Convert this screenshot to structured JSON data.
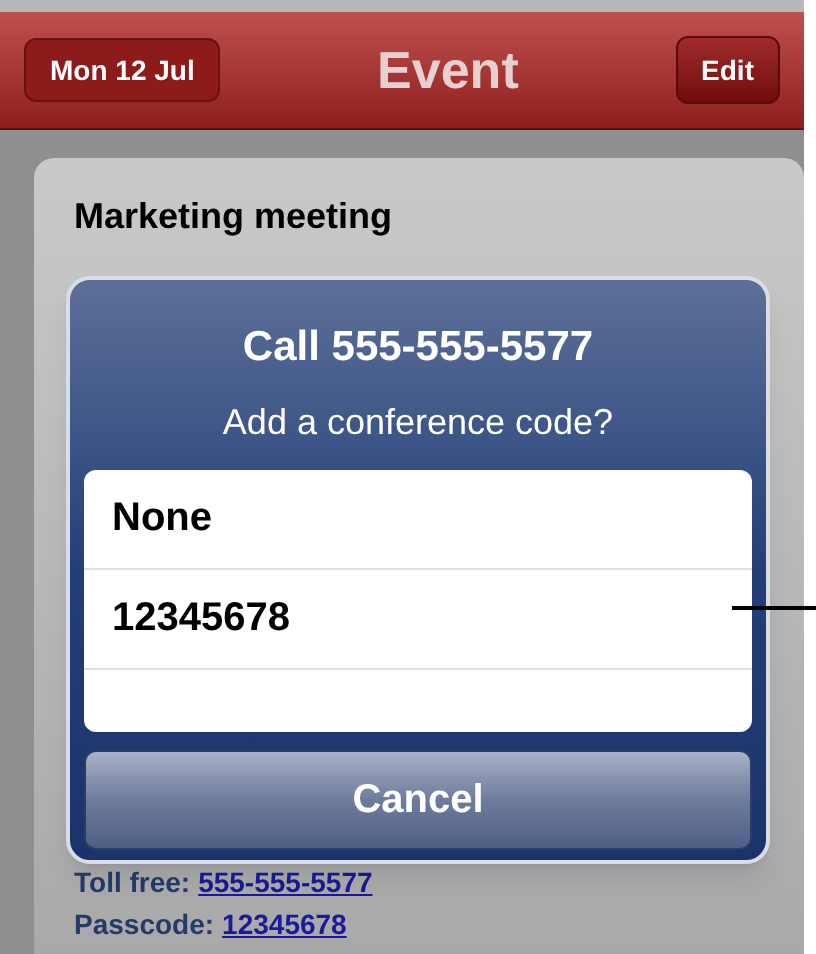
{
  "nav_bar": {
    "back_button": "Mon 12 Jul",
    "title": "Event",
    "edit_button": "Edit"
  },
  "event": {
    "title": "Marketing meeting",
    "toll_free_label": "Toll free:",
    "toll_free_number": "555-555-5577",
    "passcode_label": "Passcode:",
    "passcode": "12345678"
  },
  "dialog": {
    "title": "Call 555-555-5577",
    "message": "Add a conference code?",
    "options": [
      {
        "label": "None"
      },
      {
        "label": "12345678"
      }
    ],
    "cancel_button": "Cancel"
  }
}
